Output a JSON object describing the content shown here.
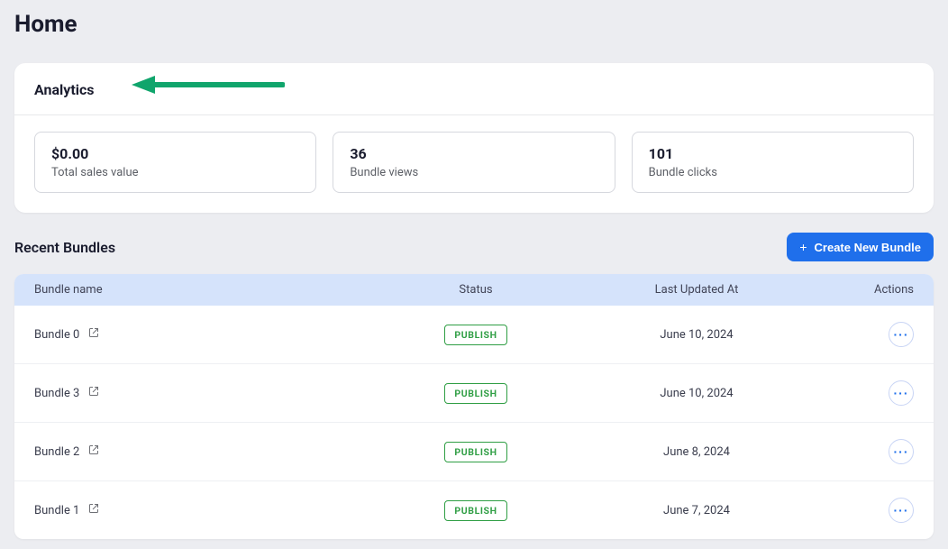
{
  "page_title": "Home",
  "analytics": {
    "heading": "Analytics",
    "metrics": [
      {
        "value": "$0.00",
        "label": "Total sales value"
      },
      {
        "value": "36",
        "label": "Bundle views"
      },
      {
        "value": "101",
        "label": "Bundle clicks"
      }
    ]
  },
  "recent": {
    "heading": "Recent Bundles",
    "create_button_label": "Create New Bundle"
  },
  "table": {
    "columns": {
      "name": "Bundle name",
      "status": "Status",
      "updated": "Last Updated At",
      "actions": "Actions"
    },
    "rows": [
      {
        "name": "Bundle 0",
        "status": "PUBLISH",
        "updated_at": "June 10, 2024"
      },
      {
        "name": "Bundle 3",
        "status": "PUBLISH",
        "updated_at": "June 10, 2024"
      },
      {
        "name": "Bundle 2",
        "status": "PUBLISH",
        "updated_at": "June 8, 2024"
      },
      {
        "name": "Bundle 1",
        "status": "PUBLISH",
        "updated_at": "June 7, 2024"
      }
    ]
  },
  "annotation": {
    "arrow_color": "#10a56c"
  }
}
